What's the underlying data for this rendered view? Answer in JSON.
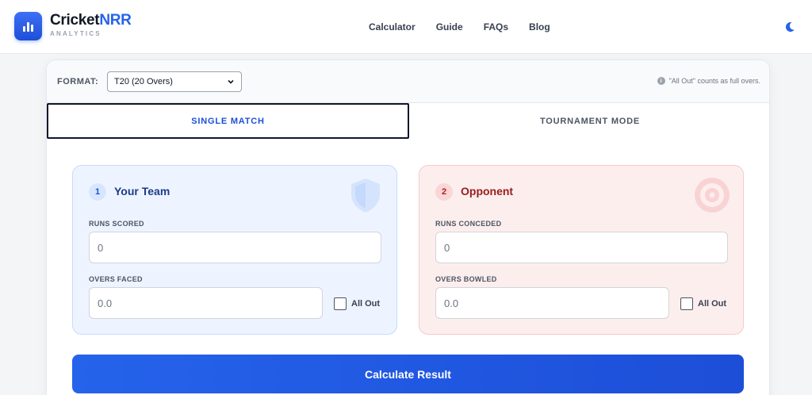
{
  "brand": {
    "name_main": "Cricket",
    "name_accent": "NRR",
    "subtitle": "ANALYTICS"
  },
  "nav": {
    "items": [
      "Calculator",
      "Guide",
      "FAQs",
      "Blog"
    ]
  },
  "format": {
    "label": "FORMAT:",
    "selected": "T20 (20 Overs)",
    "note": "\"All Out\" counts as full overs."
  },
  "tabs": {
    "single": "SINGLE MATCH",
    "tournament": "TOURNAMENT MODE",
    "active": "single"
  },
  "your_team": {
    "step": "1",
    "title": "Your Team",
    "runs_label": "RUNS SCORED",
    "runs_placeholder": "0",
    "overs_label": "OVERS FACED",
    "overs_placeholder": "0.0",
    "allout_label": "All Out"
  },
  "opponent": {
    "step": "2",
    "title": "Opponent",
    "runs_label": "RUNS CONCEDED",
    "runs_placeholder": "0",
    "overs_label": "OVERS BOWLED",
    "overs_placeholder": "0.0",
    "allout_label": "All Out"
  },
  "calculate": {
    "label": "Calculate Result"
  },
  "icons": {
    "logo": "bar-chart-icon",
    "theme": "moon-icon",
    "info": "info-icon",
    "team_watermark": "shield-icon",
    "opponent_watermark": "target-icon"
  },
  "colors": {
    "accent": "#2563eb",
    "team": "#1e3a8a",
    "opponent": "#991b1b"
  }
}
